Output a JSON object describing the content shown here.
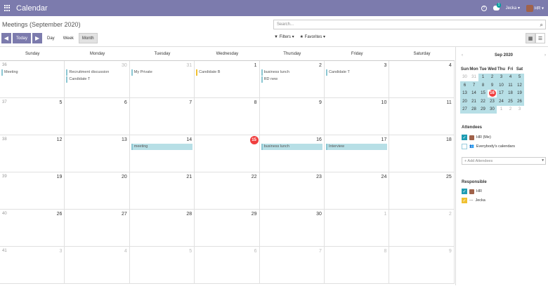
{
  "topbar": {
    "app_title": "Calendar",
    "help": "?",
    "chat_badge": "1",
    "user1": "Jecka",
    "user2": "HR",
    "caret": "▾"
  },
  "control": {
    "breadcrumb": "Meetings (September 2020)",
    "search_placeholder": "Search...",
    "prev": "◀",
    "today": "Today",
    "next": "▶",
    "day": "Day",
    "week": "Week",
    "month": "Month",
    "filters": "▼ Filters ▾",
    "favorites": "★ Favorites ▾"
  },
  "calendar": {
    "weekdays": [
      "Sunday",
      "Monday",
      "Tuesday",
      "Wednesday",
      "Thursday",
      "Friday",
      "Saturday"
    ],
    "weeks": [
      {
        "wk": "36",
        "days": [
          {
            "n": "",
            "o": true,
            "ev": [
              {
                "t": "Meeting",
                "c": "blue"
              }
            ]
          },
          {
            "n": "30",
            "o": true,
            "ev": [
              {
                "t": "Recruitment discussion",
                "c": "blue"
              },
              {
                "t": "Candidate T",
                "c": "blue"
              }
            ]
          },
          {
            "n": "31",
            "o": true,
            "ev": [
              {
                "t": "My Private",
                "c": "blue"
              }
            ]
          },
          {
            "n": "1",
            "ev": [
              {
                "t": "Candidate B",
                "c": "yellow"
              }
            ]
          },
          {
            "n": "2",
            "ev": [
              {
                "t": "business lunch",
                "c": "blue"
              },
              {
                "t": "RD new",
                "c": "blue"
              }
            ]
          },
          {
            "n": "3",
            "ev": [
              {
                "t": "Candidate T",
                "c": "blue"
              }
            ]
          },
          {
            "n": "4",
            "ev": []
          }
        ]
      },
      {
        "wk": "37",
        "days": [
          {
            "n": "5"
          },
          {
            "n": "6"
          },
          {
            "n": "7"
          },
          {
            "n": "8"
          },
          {
            "n": "9"
          },
          {
            "n": "10"
          },
          {
            "n": "11"
          }
        ]
      },
      {
        "wk": "38",
        "days": [
          {
            "n": "12"
          },
          {
            "n": "13"
          },
          {
            "n": "14",
            "ev": [
              {
                "t": "meeting",
                "c": "filled"
              }
            ]
          },
          {
            "n": "15",
            "today": true
          },
          {
            "n": "16",
            "ev": [
              {
                "t": "business lunch",
                "c": "filled"
              }
            ]
          },
          {
            "n": "17",
            "ev": [
              {
                "t": "Interview",
                "c": "filled"
              }
            ]
          },
          {
            "n": "18"
          }
        ]
      },
      {
        "wk": "39",
        "days": [
          {
            "n": "19"
          },
          {
            "n": "20"
          },
          {
            "n": "21"
          },
          {
            "n": "22"
          },
          {
            "n": "23"
          },
          {
            "n": "24"
          },
          {
            "n": "25"
          }
        ]
      },
      {
        "wk": "40",
        "days": [
          {
            "n": "26"
          },
          {
            "n": "27"
          },
          {
            "n": "28"
          },
          {
            "n": "29"
          },
          {
            "n": "30"
          },
          {
            "n": "1",
            "o": true
          },
          {
            "n": "2",
            "o": true
          }
        ]
      },
      {
        "wk": "41",
        "days": [
          {
            "n": "3",
            "o": true
          },
          {
            "n": "4",
            "o": true
          },
          {
            "n": "5",
            "o": true
          },
          {
            "n": "6",
            "o": true
          },
          {
            "n": "7",
            "o": true
          },
          {
            "n": "8",
            "o": true
          },
          {
            "n": "9",
            "o": true
          }
        ]
      }
    ]
  },
  "sidebar": {
    "month_label": "Sep 2020",
    "prev": "‹",
    "next": "›",
    "mini_weekdays": [
      "Sun",
      "Mon",
      "Tue",
      "Wed",
      "Thu",
      "Fri",
      "Sat"
    ],
    "mini_rows": [
      [
        {
          "d": "30",
          "o": true
        },
        {
          "d": "31",
          "o": true
        },
        {
          "d": "1"
        },
        {
          "d": "2"
        },
        {
          "d": "3"
        },
        {
          "d": "4"
        },
        {
          "d": "5"
        }
      ],
      [
        {
          "d": "6"
        },
        {
          "d": "7"
        },
        {
          "d": "8"
        },
        {
          "d": "9"
        },
        {
          "d": "10"
        },
        {
          "d": "11"
        },
        {
          "d": "12"
        }
      ],
      [
        {
          "d": "13"
        },
        {
          "d": "14"
        },
        {
          "d": "15"
        },
        {
          "d": "16",
          "t": true
        },
        {
          "d": "17"
        },
        {
          "d": "18"
        },
        {
          "d": "19"
        }
      ],
      [
        {
          "d": "20"
        },
        {
          "d": "21"
        },
        {
          "d": "22"
        },
        {
          "d": "23"
        },
        {
          "d": "24"
        },
        {
          "d": "25"
        },
        {
          "d": "26"
        }
      ],
      [
        {
          "d": "27"
        },
        {
          "d": "28"
        },
        {
          "d": "29"
        },
        {
          "d": "30"
        },
        {
          "d": "1",
          "o": true
        },
        {
          "d": "2",
          "o": true
        },
        {
          "d": "3",
          "o": true
        }
      ]
    ],
    "attendees_title": "Attendees",
    "attendee_me": "HR (Me)",
    "attendee_all": "Everybody's calendars",
    "add_attendees": "+ Add Attendees",
    "responsible_title": "Responsible",
    "resp1": "HR",
    "resp2": "Jecka",
    "resp2_prefix": "---"
  },
  "colors": {
    "brand": "#7c7bad",
    "event_blue": "#b7dfe6",
    "event_yellow": "#f0c030",
    "today_red": "#f03e3e"
  }
}
